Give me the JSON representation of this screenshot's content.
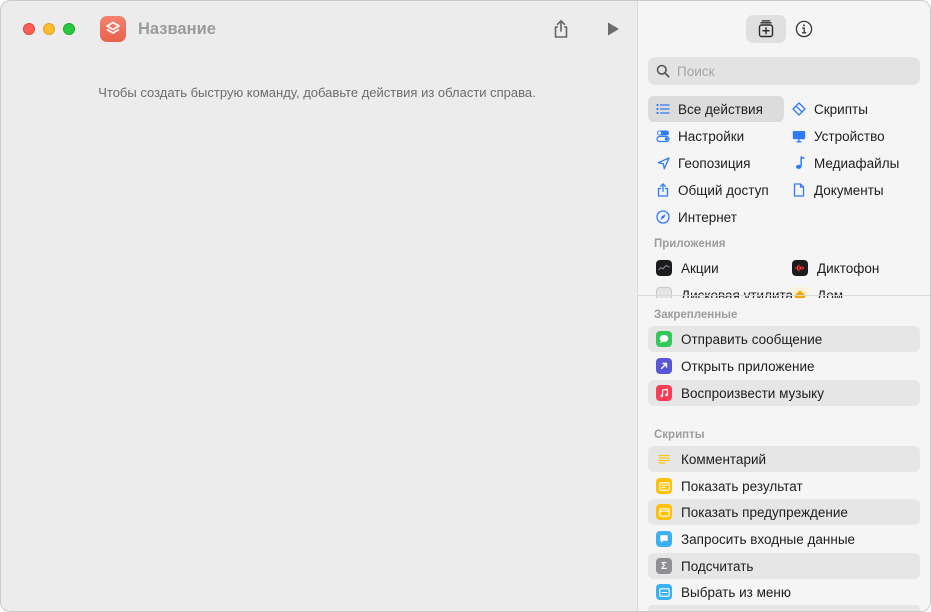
{
  "window": {
    "title": "Название"
  },
  "editor": {
    "hint": "Чтобы создать быструю команду, добавьте действия из области справа."
  },
  "library": {
    "search": {
      "placeholder": "Поиск",
      "value": ""
    },
    "categories": [
      {
        "label": "Все действия",
        "icon": "list-icon",
        "selected": true
      },
      {
        "label": "Скрипты",
        "icon": "scripts-icon"
      },
      {
        "label": "Настройки",
        "icon": "toggles-icon"
      },
      {
        "label": "Устройство",
        "icon": "display-icon"
      },
      {
        "label": "Геопозиция",
        "icon": "location-arrow-icon"
      },
      {
        "label": "Медиафайлы",
        "icon": "music-note-icon"
      },
      {
        "label": "Общий доступ",
        "icon": "share-icon"
      },
      {
        "label": "Документы",
        "icon": "document-icon"
      },
      {
        "label": "Интернет",
        "icon": "compass-icon"
      }
    ],
    "apps_title": "Приложения",
    "apps": [
      {
        "label": "Акции",
        "icon": "stocks-app-icon"
      },
      {
        "label": "Диктофон",
        "icon": "voice-memos-app-icon"
      },
      {
        "label": "Дисковая утилита",
        "icon": "disk-utility-app-icon"
      },
      {
        "label": "Дом",
        "icon": "home-app-icon"
      }
    ],
    "pinned_title": "Закрепленные",
    "pinned": [
      {
        "label": "Отправить сообщение",
        "icon": "messages-icon",
        "color": "#34c759"
      },
      {
        "label": "Открыть приложение",
        "icon": "open-app-arrow-icon",
        "color": "#5856d6"
      },
      {
        "label": "Воспроизвести музыку",
        "icon": "music-icon",
        "color": "#fa3c55"
      }
    ],
    "scripts_title": "Скрипты",
    "scripts": [
      {
        "label": "Комментарий",
        "icon": "comment-lines-icon",
        "color": "#f5c518"
      },
      {
        "label": "Показать результат",
        "icon": "show-result-icon",
        "color": "#ffc107"
      },
      {
        "label": "Показать предупреждение",
        "icon": "alert-icon",
        "color": "#ffc107"
      },
      {
        "label": "Запросить входные данные",
        "icon": "ask-input-icon",
        "color": "#3db0f0"
      },
      {
        "label": "Подсчитать",
        "icon": "sigma-icon",
        "color": "#8e8e93"
      },
      {
        "label": "Выбрать из меню",
        "icon": "menu-choose-icon",
        "color": "#3db0f0"
      }
    ]
  }
}
